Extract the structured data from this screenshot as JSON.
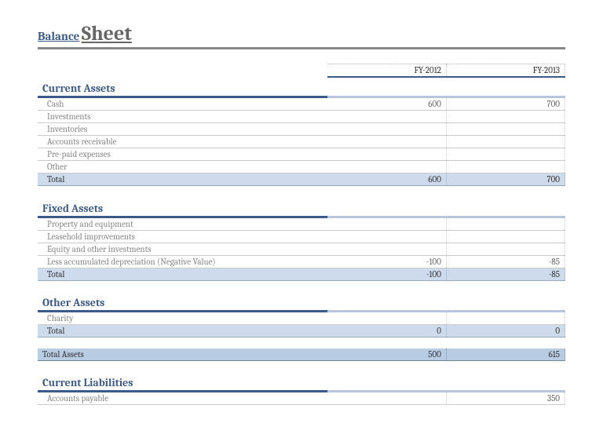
{
  "title": {
    "small": "Balance",
    "big": "Sheet"
  },
  "years": {
    "y1": "FY-2012",
    "y2": "FY-2013"
  },
  "sections": {
    "current_assets": {
      "heading": "Current Assets",
      "rows": {
        "cash": {
          "label": "Cash",
          "y1": "600",
          "y2": "700"
        },
        "investments": {
          "label": "Investments",
          "y1": "",
          "y2": ""
        },
        "inventories": {
          "label": "Inventories",
          "y1": "",
          "y2": ""
        },
        "ar": {
          "label": "Accounts receivable",
          "y1": "",
          "y2": ""
        },
        "prepaid": {
          "label": "Pre-paid expenses",
          "y1": "",
          "y2": ""
        },
        "other": {
          "label": "Other",
          "y1": "",
          "y2": ""
        }
      },
      "total": {
        "label": "Total",
        "y1": "600",
        "y2": "700"
      }
    },
    "fixed_assets": {
      "heading": "Fixed Assets",
      "rows": {
        "pe": {
          "label": "Property and equipment",
          "y1": "",
          "y2": ""
        },
        "lease": {
          "label": "Leasehold improvements",
          "y1": "",
          "y2": ""
        },
        "equity": {
          "label": "Equity and other investments",
          "y1": "",
          "y2": ""
        },
        "dep": {
          "label": "Less accumulated depreciation (Negative Value)",
          "y1": "-100",
          "y2": "-85"
        }
      },
      "total": {
        "label": "Total",
        "y1": "-100",
        "y2": "-85"
      }
    },
    "other_assets": {
      "heading": "Other Assets",
      "rows": {
        "charity": {
          "label": "Charity",
          "y1": "",
          "y2": ""
        }
      },
      "total": {
        "label": "Total",
        "y1": "0",
        "y2": "0"
      }
    },
    "total_assets": {
      "label": "Total Assets",
      "y1": "500",
      "y2": "615"
    },
    "current_liabilities": {
      "heading": "Current Liabilities",
      "rows": {
        "ap": {
          "label": "Accounts payable",
          "y1": "",
          "y2": "350"
        }
      }
    }
  },
  "chart_data": {
    "type": "table",
    "title": "Balance Sheet",
    "categories": [
      "FY-2012",
      "FY-2013"
    ],
    "series": [
      {
        "name": "Cash",
        "values": [
          600,
          700
        ]
      },
      {
        "name": "Investments",
        "values": [
          null,
          null
        ]
      },
      {
        "name": "Inventories",
        "values": [
          null,
          null
        ]
      },
      {
        "name": "Accounts receivable",
        "values": [
          null,
          null
        ]
      },
      {
        "name": "Pre-paid expenses",
        "values": [
          null,
          null
        ]
      },
      {
        "name": "Other",
        "values": [
          null,
          null
        ]
      },
      {
        "name": "Current Assets Total",
        "values": [
          600,
          700
        ]
      },
      {
        "name": "Property and equipment",
        "values": [
          null,
          null
        ]
      },
      {
        "name": "Leasehold improvements",
        "values": [
          null,
          null
        ]
      },
      {
        "name": "Equity and other investments",
        "values": [
          null,
          null
        ]
      },
      {
        "name": "Less accumulated depreciation (Negative Value)",
        "values": [
          -100,
          -85
        ]
      },
      {
        "name": "Fixed Assets Total",
        "values": [
          -100,
          -85
        ]
      },
      {
        "name": "Charity",
        "values": [
          null,
          null
        ]
      },
      {
        "name": "Other Assets Total",
        "values": [
          0,
          0
        ]
      },
      {
        "name": "Total Assets",
        "values": [
          500,
          615
        ]
      },
      {
        "name": "Accounts payable",
        "values": [
          null,
          350
        ]
      }
    ]
  }
}
